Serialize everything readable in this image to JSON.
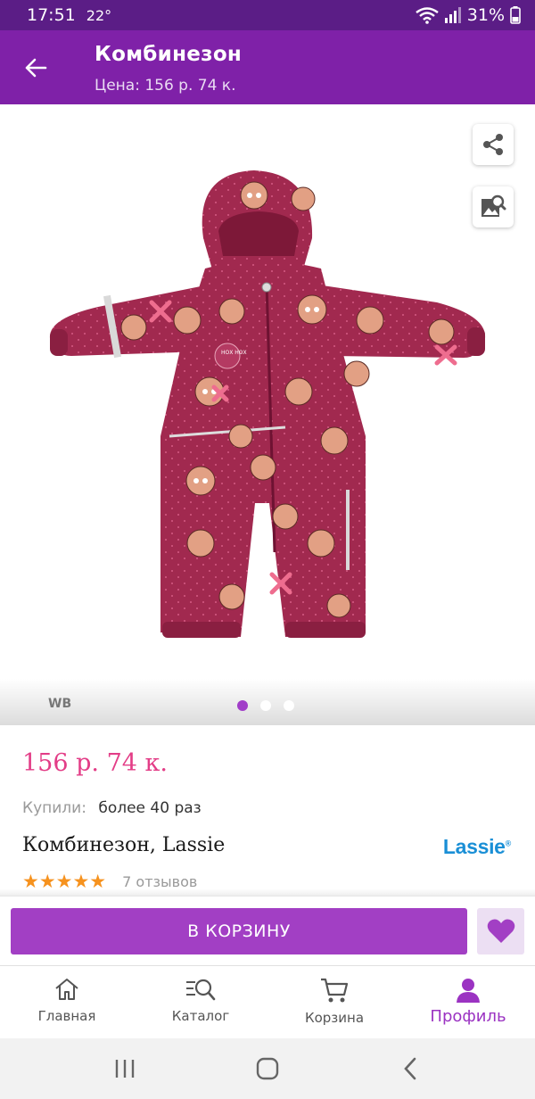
{
  "status_bar": {
    "time": "17:51",
    "temperature": "22°",
    "battery": "31%"
  },
  "app_bar": {
    "title": "Комбинезон",
    "subtitle": "Цена: 156 р. 74 к."
  },
  "gallery": {
    "watermark": "WB",
    "slides_total": 3,
    "active_slide": 1,
    "print_text": "НОХ НОХ"
  },
  "product": {
    "price": "156 р. 74 к.",
    "bought_label": "Купили:",
    "bought_value": "более 40 раз",
    "name": "Комбинезон, Lassie",
    "brand": "Lassie",
    "rating_stars": 5,
    "stars": "★★★★★",
    "reviews": "7 отзывов"
  },
  "actions": {
    "cart_label": "В КОРЗИНУ"
  },
  "bottom_nav": {
    "items": [
      {
        "label": "Главная",
        "icon": "home-icon"
      },
      {
        "label": "Каталог",
        "icon": "catalog-search-icon"
      },
      {
        "label": "Корзина",
        "icon": "cart-icon"
      },
      {
        "label": "Профиль",
        "icon": "profile-icon"
      }
    ],
    "active_index": 3
  },
  "colors": {
    "primary": "#7f21a8",
    "status_bar": "#5b1d86",
    "accent": "#a23fc4",
    "price": "#e33d87",
    "star": "#f6921e",
    "brand": "#1a8fd6"
  }
}
